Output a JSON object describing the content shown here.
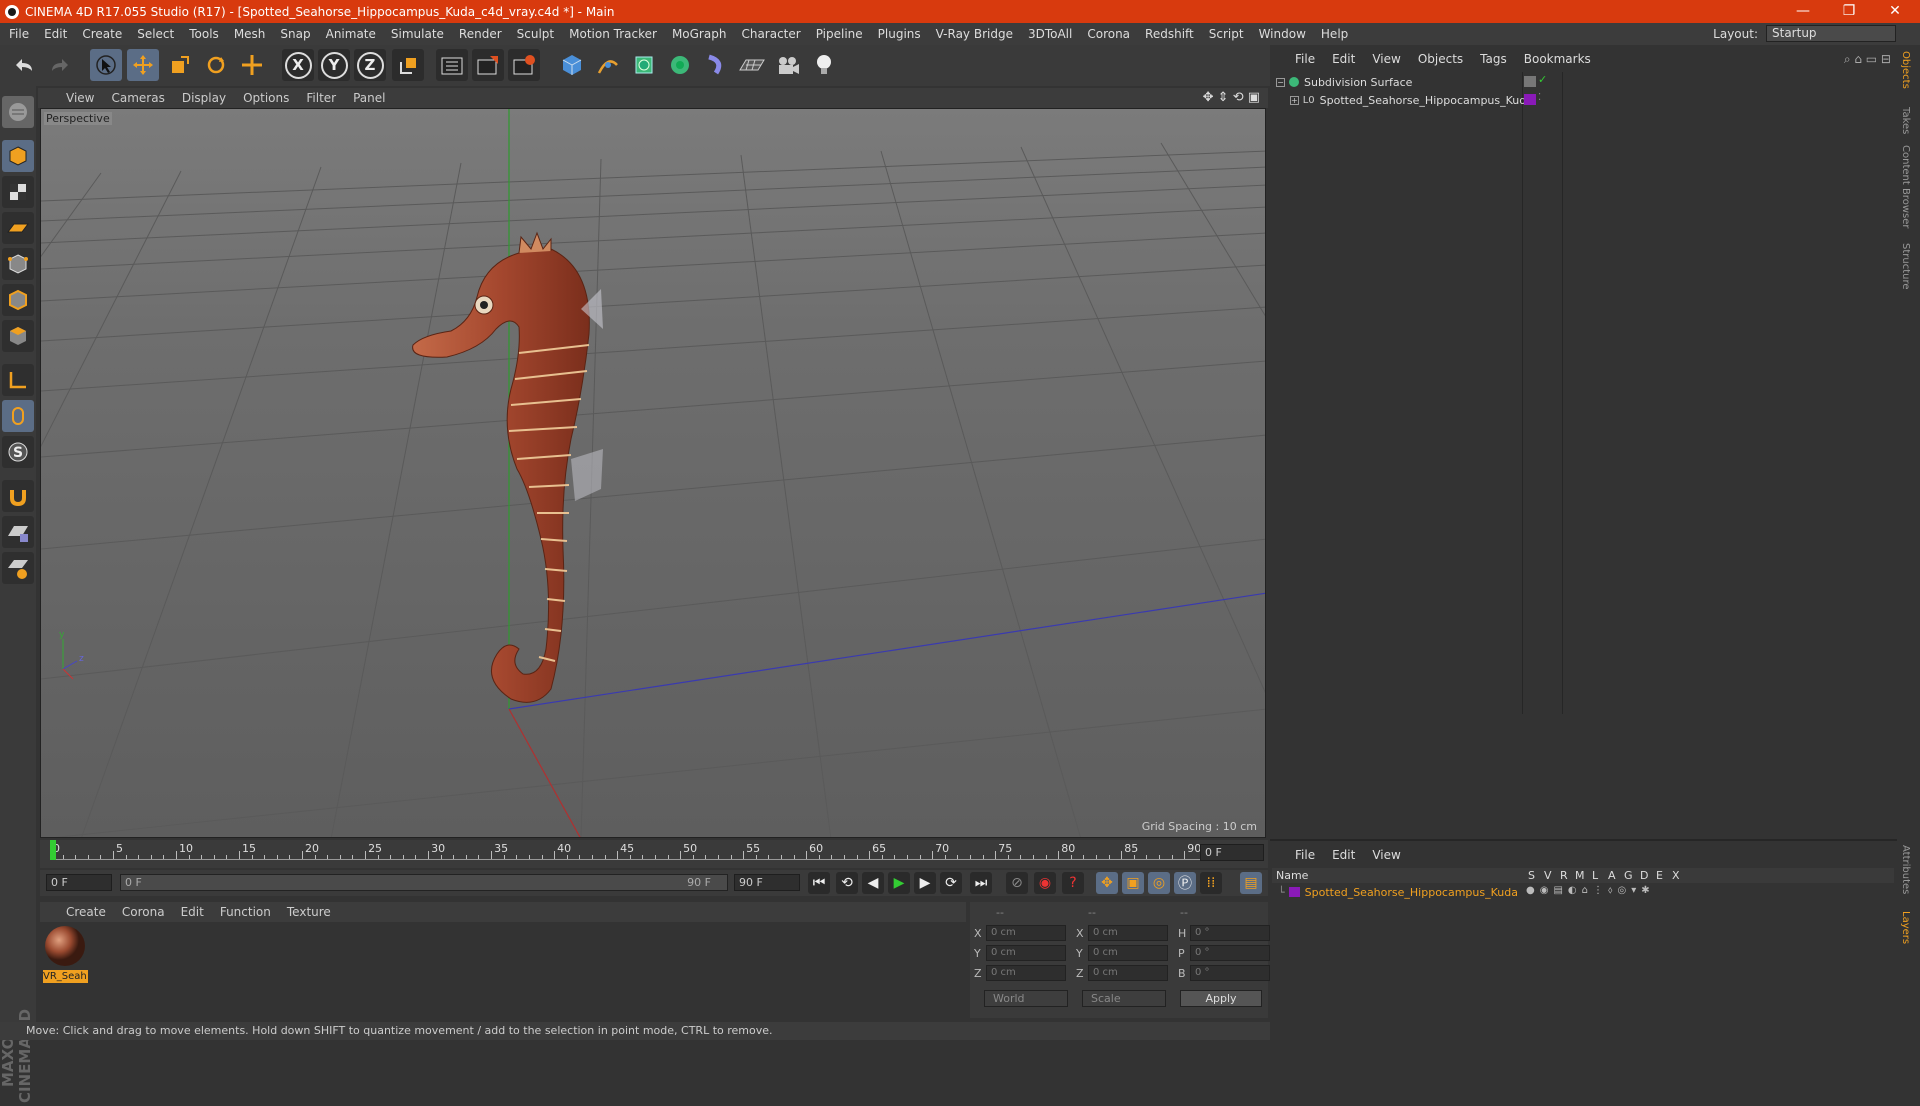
{
  "window": {
    "title": "CINEMA 4D R17.055 Studio (R17) - [Spotted_Seahorse_Hippocampus_Kuda_c4d_vray.c4d *] - Main",
    "minimize": "—",
    "restore": "❐",
    "close": "✕"
  },
  "menu": [
    "File",
    "Edit",
    "Create",
    "Select",
    "Tools",
    "Mesh",
    "Snap",
    "Animate",
    "Simulate",
    "Render",
    "Sculpt",
    "Motion Tracker",
    "MoGraph",
    "Character",
    "Pipeline",
    "Plugins",
    "V-Ray Bridge",
    "3DToAll",
    "Corona",
    "Redshift",
    "Script",
    "Window",
    "Help"
  ],
  "layout": {
    "label": "Layout:",
    "value": "Startup"
  },
  "toolbar": {
    "x": "X",
    "y": "Y",
    "z": "Z"
  },
  "viewport": {
    "menu": [
      "View",
      "Cameras",
      "Display",
      "Options",
      "Filter",
      "Panel"
    ],
    "label": "Perspective",
    "grid_spacing": "Grid Spacing : 10 cm"
  },
  "timeline": {
    "ticks": [
      "0",
      "5",
      "10",
      "15",
      "20",
      "25",
      "30",
      "35",
      "40",
      "45",
      "50",
      "55",
      "60",
      "65",
      "70",
      "75",
      "80",
      "85",
      "90"
    ],
    "current": "0 F",
    "start": "0 F",
    "range_start": "0 F",
    "range_end": "90 F",
    "end": "90 F"
  },
  "material": {
    "menu": [
      "Create",
      "Corona",
      "Edit",
      "Function",
      "Texture"
    ],
    "name": "VR_Seah"
  },
  "coords": {
    "header": [
      "--",
      "--",
      "--"
    ],
    "rows": [
      {
        "a": "X",
        "av": "0 cm",
        "b": "X",
        "bv": "0 cm",
        "c": "H",
        "cv": "0 °"
      },
      {
        "a": "Y",
        "av": "0 cm",
        "b": "Y",
        "bv": "0 cm",
        "c": "P",
        "cv": "0 °"
      },
      {
        "a": "Z",
        "av": "0 cm",
        "b": "Z",
        "bv": "0 cm",
        "c": "B",
        "cv": "0 °"
      }
    ],
    "world": "World",
    "scale": "Scale",
    "apply": "Apply"
  },
  "objects": {
    "menu": [
      "File",
      "Edit",
      "View",
      "Objects",
      "Tags",
      "Bookmarks"
    ],
    "items": [
      "Subdivision Surface",
      "Spotted_Seahorse_Hippocampus_Kuda"
    ]
  },
  "layers": {
    "menu": [
      "File",
      "Edit",
      "View"
    ],
    "header": {
      "name": "Name",
      "cols": [
        "S",
        "V",
        "R",
        "M",
        "L",
        "A",
        "G",
        "D",
        "E",
        "X"
      ]
    },
    "row": "Spotted_Seahorse_Hippocampus_Kuda"
  },
  "status": "Move: Click and drag to move elements. Hold down SHIFT to quantize movement / add to the selection in point mode, CTRL to remove.",
  "side_tabs": [
    "Objects",
    "Takes",
    "Content Browser",
    "Structure"
  ],
  "side_tabs_lower": [
    "Attributes",
    "Layers"
  ],
  "brand": "MAXON CINEMA 4D"
}
